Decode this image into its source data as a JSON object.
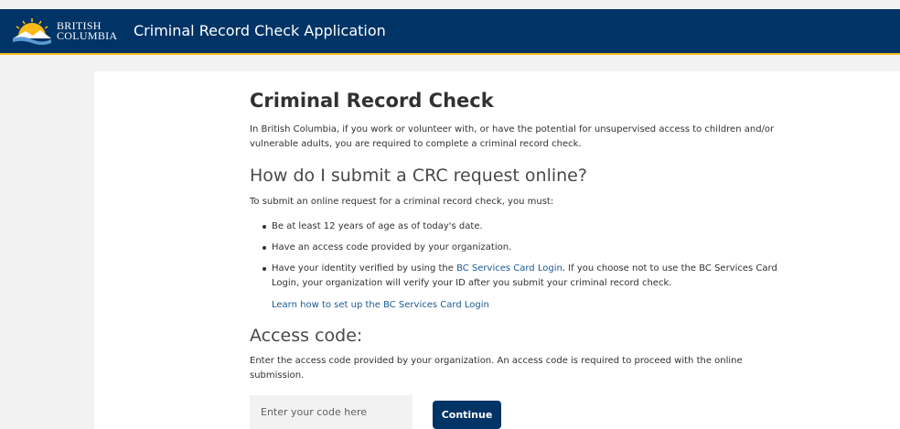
{
  "header": {
    "logo_line1": "BRITISH",
    "logo_line2": "COLUMBIA",
    "title": "Criminal Record Check Application",
    "brand_color": "#003366",
    "accent_color": "#fcba19"
  },
  "main": {
    "heading": "Criminal Record Check",
    "intro": "In British Columbia, if you work or volunteer with, or have the potential for unsupervised access to children and/or vulnerable adults, you are required to complete a criminal record check.",
    "submit_heading": "How do I submit a CRC request online?",
    "submit_intro": "To submit an online request for a criminal record check, you must:",
    "bullets": [
      "Be at least 12 years of age as of today's date.",
      "Have an access code provided by your organization."
    ],
    "bullet3": {
      "before": "Have your identity verified by using the ",
      "link": "BC Services Card Login",
      "after": ". If you choose not to use the BC Services Card Login, your organization will verify your ID after you submit your criminal record check."
    },
    "learn_link": "Learn how to set up the BC Services Card Login",
    "access_heading": "Access code:",
    "access_intro": "Enter the access code provided by your organization. An access code is required to proceed with the online submission.",
    "access_input_placeholder": "Enter your code here",
    "access_input_value": "",
    "continue_label": "Continue"
  }
}
